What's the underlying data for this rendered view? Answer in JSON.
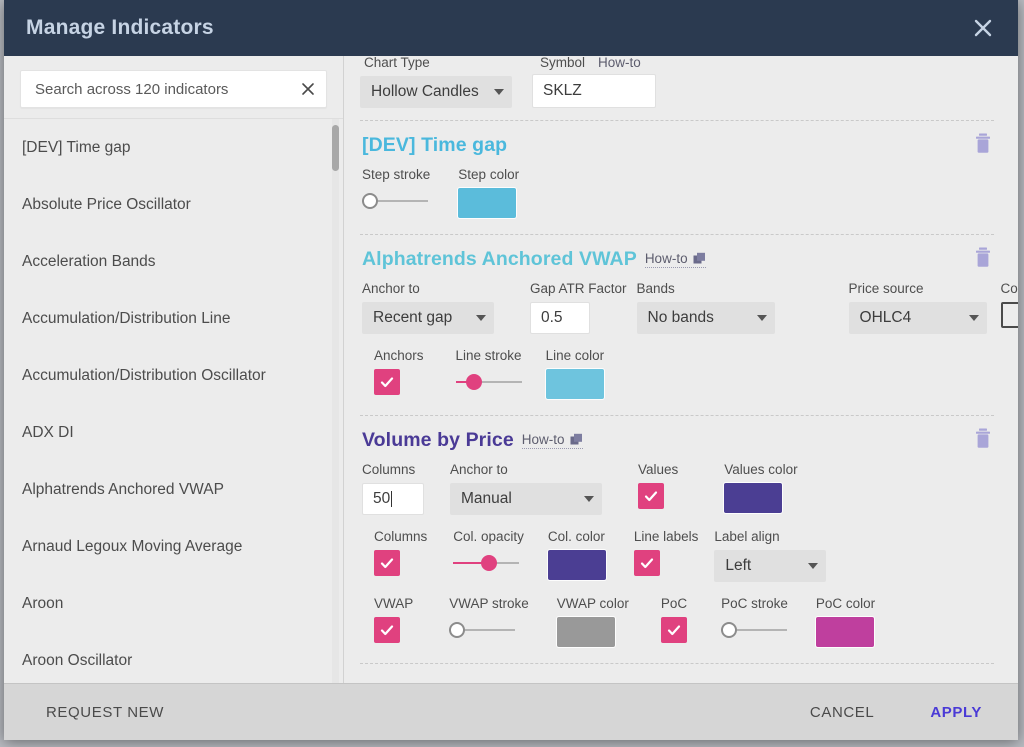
{
  "window": {
    "title": "Manage Indicators",
    "close_icon": "close-icon"
  },
  "search": {
    "placeholder": "Search across 120 indicators",
    "value": "",
    "clear_icon": "close-icon"
  },
  "indicator_list": [
    {
      "label": "[DEV] Time gap"
    },
    {
      "label": "Absolute Price Oscillator"
    },
    {
      "label": "Acceleration Bands"
    },
    {
      "label": "Accumulation/Distribution Line"
    },
    {
      "label": "Accumulation/Distribution Oscillator"
    },
    {
      "label": "ADX DI"
    },
    {
      "label": "Alphatrends Anchored VWAP"
    },
    {
      "label": "Arnaud Legoux Moving Average"
    },
    {
      "label": "Aroon"
    },
    {
      "label": "Aroon Oscillator"
    }
  ],
  "top_section": {
    "chart_type_label": "Chart Type",
    "chart_type_value": "Hollow Candles",
    "symbol_label": "Symbol",
    "symbol_howto": "How-to",
    "symbol_value": "SKLZ"
  },
  "sections": [
    {
      "title": "[DEV] Time gap",
      "title_color": "#4ab8dd",
      "howto": null,
      "delete_icon": "trash-icon",
      "rows": [
        {
          "controls": [
            {
              "label": "Step stroke",
              "type": "slider",
              "value": 0,
              "knob": "empty"
            },
            {
              "label": "Step color",
              "type": "swatch",
              "color": "#5bbcdb"
            }
          ]
        }
      ]
    },
    {
      "title": "Alphatrends Anchored VWAP",
      "title_color": "#5fc4d8",
      "howto": "How-to",
      "delete_icon": "trash-icon",
      "rows": [
        {
          "controls": [
            {
              "label": "Anchor to",
              "type": "select",
              "value": "Recent gap"
            },
            {
              "label": "Gap ATR Factor",
              "type": "text",
              "value": "0.5"
            },
            {
              "label": "Bands",
              "type": "select",
              "value": "No bands"
            },
            {
              "label": "Price source",
              "type": "select",
              "value": "OHLC4"
            },
            {
              "label": "Continuous?",
              "type": "checkbox",
              "checked": false
            }
          ]
        },
        {
          "controls": [
            {
              "label": "Anchors",
              "type": "checkbox",
              "checked": true
            },
            {
              "label": "Line stroke",
              "type": "slider",
              "value": 20,
              "knob": "filled"
            },
            {
              "label": "Line color",
              "type": "swatch",
              "color": "#6ec4de"
            }
          ]
        }
      ]
    },
    {
      "title": "Volume by Price",
      "title_color": "#4a3a96",
      "howto": "How-to",
      "delete_icon": "trash-icon",
      "rows": [
        {
          "controls": [
            {
              "label": "Columns",
              "type": "text",
              "value": "50",
              "focused": true
            },
            {
              "label": "Anchor to",
              "type": "select",
              "value": "Manual"
            },
            {
              "label": "Values",
              "type": "checkbox",
              "checked": true
            },
            {
              "label": "Values color",
              "type": "swatch",
              "color": "#4b3e93"
            }
          ]
        },
        {
          "controls": [
            {
              "label": "Columns",
              "type": "checkbox",
              "checked": true
            },
            {
              "label": "Col. opacity",
              "type": "slider",
              "value": 55,
              "knob": "filled"
            },
            {
              "label": "Col. color",
              "type": "swatch",
              "color": "#4b3e93"
            },
            {
              "label": "Line labels",
              "type": "checkbox",
              "checked": true
            },
            {
              "label": "Label align",
              "type": "select",
              "value": "Left"
            }
          ]
        },
        {
          "controls": [
            {
              "label": "VWAP",
              "type": "checkbox",
              "checked": true
            },
            {
              "label": "VWAP stroke",
              "type": "slider",
              "value": 0,
              "knob": "empty"
            },
            {
              "label": "VWAP color",
              "type": "swatch",
              "color": "#999999"
            },
            {
              "label": "PoC",
              "type": "checkbox",
              "checked": true
            },
            {
              "label": "PoC stroke",
              "type": "slider",
              "value": 0,
              "knob": "empty"
            },
            {
              "label": "PoC color",
              "type": "swatch",
              "color": "#bf3f9e"
            }
          ]
        }
      ]
    }
  ],
  "footer": {
    "request_new": "REQUEST NEW",
    "cancel": "CANCEL",
    "apply": "APPLY",
    "apply_color": "#4a3ad6"
  }
}
